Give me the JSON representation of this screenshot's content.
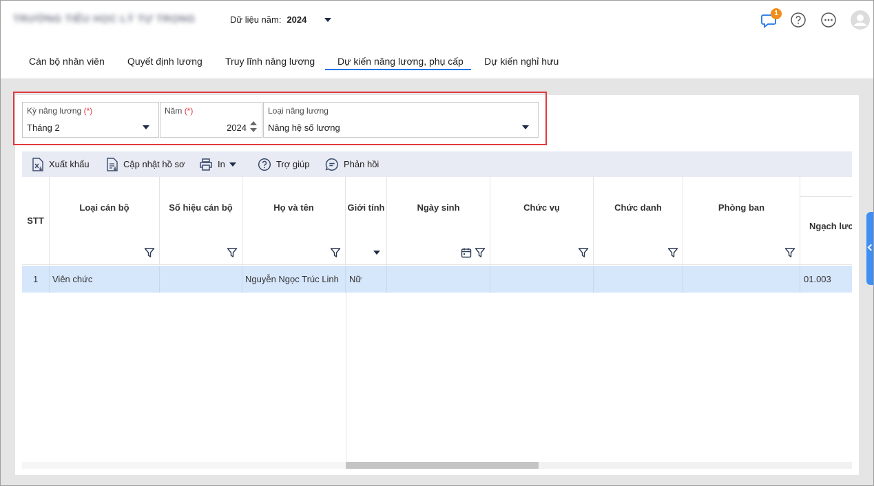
{
  "header": {
    "school_name": "TRƯỜNG TIỂU HỌC LÝ TỰ TRỌNG",
    "year_label": "Dữ liệu năm:",
    "year_value": "2024",
    "notification_count": "1"
  },
  "tabs": [
    {
      "label": "Cán bộ nhân viên"
    },
    {
      "label": "Quyết định lương"
    },
    {
      "label": "Truy lĩnh nâng lương"
    },
    {
      "label": "Dự kiến nâng lương, phụ cấp",
      "active": true
    },
    {
      "label": "Dự kiến nghỉ hưu"
    }
  ],
  "filters": {
    "period": {
      "label": "Kỳ nâng lương",
      "required": "(*)",
      "value": "Tháng 2"
    },
    "year": {
      "label": "Năm",
      "required": "(*)",
      "value": "2024"
    },
    "type": {
      "label": "Loại nâng lương",
      "value": "Nâng hệ số lương"
    }
  },
  "toolbar": {
    "export": "Xuất khẩu",
    "update": "Cập nhật hồ sơ",
    "print": "In",
    "help": "Trợ giúp",
    "feedback": "Phản hồi"
  },
  "grid": {
    "columns": [
      "STT",
      "Loại cán bộ",
      "Số hiệu cán bộ",
      "Họ và tên",
      "Giới tính",
      "Ngày sinh",
      "Chức vụ",
      "Chức danh",
      "Phòng ban",
      "Ngạch lươ"
    ],
    "rows": [
      {
        "stt": "1",
        "loai": "Viên chức",
        "so_hieu": "",
        "ho_ten": "Nguyễn Ngọc Trúc Linh",
        "gioi_tinh": "Nữ",
        "ngay_sinh": "",
        "chuc_vu": "",
        "chuc_danh": "",
        "phong_ban": "",
        "ngach": "01.003"
      }
    ]
  },
  "colors": {
    "accent": "#1a73e8",
    "highlight_border": "#e0393e",
    "badge": "#f28c1b",
    "selected_row": "#d6e6fb",
    "toolbar_bg": "#e8ebf4"
  }
}
